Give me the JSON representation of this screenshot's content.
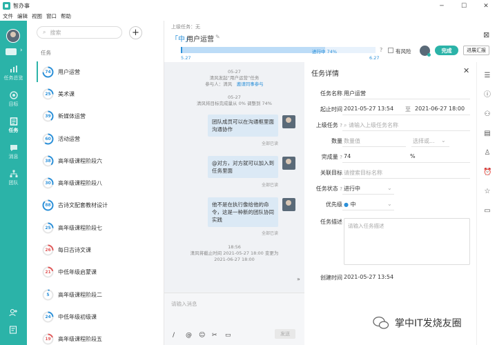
{
  "app": {
    "name": "智办事"
  },
  "window_controls": {
    "minimize": "─",
    "maximize": "☐",
    "close": "✕"
  },
  "menu": [
    "文件",
    "编辑",
    "视图",
    "窗口",
    "帮助"
  ],
  "nav": {
    "items": [
      {
        "label": "任务总览",
        "icon": "chart-icon"
      },
      {
        "label": "目标",
        "icon": "target-icon"
      },
      {
        "label": "任务",
        "icon": "task-icon"
      },
      {
        "label": "消息",
        "icon": "message-icon"
      },
      {
        "label": "团队",
        "icon": "team-icon"
      }
    ],
    "active": "任务"
  },
  "task_panel": {
    "search_placeholder": "搜索",
    "add_label": "+",
    "heading": "任务",
    "tasks": [
      {
        "name": "用户运营",
        "progress": 74,
        "color": "#2b90d9"
      },
      {
        "name": "美术课",
        "progress": 25,
        "color": "#2b90d9"
      },
      {
        "name": "新媒体运营",
        "progress": 39,
        "color": "#2b90d9"
      },
      {
        "name": "活动运营",
        "progress": 60,
        "color": "#2b90d9"
      },
      {
        "name": "高年级课程阶段六",
        "progress": 38,
        "color": "#2b90d9"
      },
      {
        "name": "高年级课程阶段八",
        "progress": 30,
        "color": "#2b90d9"
      },
      {
        "name": "古诗文配套教材设计",
        "progress": 88,
        "color": "#2b90d9"
      },
      {
        "name": "高年级课程阶段七",
        "progress": 25,
        "color": "#2b90d9"
      },
      {
        "name": "每日古诗文课",
        "progress": 26,
        "color": "#e05a5a"
      },
      {
        "name": "中低年级启蒙课",
        "progress": 21,
        "color": "#e05a5a"
      },
      {
        "name": "高年级课程阶段二",
        "progress": 5,
        "color": "#2b90d9"
      },
      {
        "name": "中低年级初级课",
        "progress": 24,
        "color": "#2b90d9"
      },
      {
        "name": "高年级课程阶段五",
        "progress": 19,
        "color": "#e05a5a"
      }
    ]
  },
  "detail_header": {
    "parent": "上级任务：无",
    "priority_tag": "「中」",
    "title": "用户运营",
    "edit_icon": "✎",
    "close": "⊠",
    "progress_label": "进行中 74%",
    "progress_value": 74,
    "date_start": "5.27",
    "date_end": "6.27",
    "help": "?",
    "risk_label": "有风险",
    "complete_label": "完成",
    "report_label": "进展汇报"
  },
  "chat": {
    "sys1": {
      "date": "05-27",
      "line1": "清风发起“用户运营”任务",
      "line2_prefix": "参与人：清风",
      "link": "邀请同事参与"
    },
    "sys2": {
      "date": "05-27",
      "line1": "清风将目标完成量从 0% 调整到 74%"
    },
    "bubbles": [
      {
        "text": "团队成员可以在沟通框里面沟通协作",
        "read": "全部已读"
      },
      {
        "text": "@对方，对方就可以加入到任务里面",
        "read": "全部已读"
      },
      {
        "text": "他不是在执行像给他的命令，这是一种新的团队协同实践",
        "read": "全部已读"
      }
    ],
    "sys3": {
      "time": "18:56",
      "line1": "清风将截止时间 2021-05-27 18:00 变更为",
      "line2": "2021-06-27 18:00"
    },
    "collapse": "»",
    "composer_placeholder": "请输入消息",
    "tools": [
      "/",
      "@",
      "☺",
      "✂",
      "▭"
    ],
    "send_label": "发送"
  },
  "detail": {
    "title": "任务详情",
    "close": "✕",
    "fields": {
      "name": {
        "label": "任务名称",
        "value": "用户运营"
      },
      "start_end": {
        "label": "起止时间",
        "start": "2021-05-27 13:54",
        "sep": "至",
        "end": "2021-06-27 18:00"
      },
      "parent": {
        "label": "上级任务",
        "placeholder": "请输入上级任务名称"
      },
      "quantity": {
        "label": "数量",
        "placeholder": "数量值",
        "select_placeholder": "选择或..."
      },
      "completion": {
        "label": "完成量",
        "value": "74",
        "unit": "%"
      },
      "goal": {
        "label": "关联目标",
        "placeholder": "请搜索目标名称"
      },
      "status": {
        "label": "任务状态",
        "value": "进行中"
      },
      "priority": {
        "label": "优先级",
        "value": "中"
      },
      "description": {
        "label": "任务描述",
        "placeholder": "请输入任务描述"
      },
      "created": {
        "label": "创建时间",
        "value": "2021-05-27 13:54"
      }
    }
  },
  "watermark": {
    "text": "掌中IT发烧友圈"
  }
}
